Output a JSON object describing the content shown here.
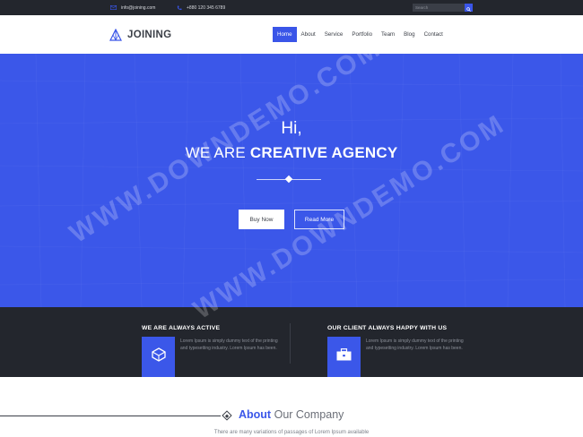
{
  "topbar": {
    "email": "info@joining.com",
    "phone": "+880 120 345 6789",
    "search_placeholder": "Search"
  },
  "header": {
    "logo_text": "JOINING",
    "nav": [
      "Home",
      "About",
      "Service",
      "Portfolio",
      "Team",
      "Blog",
      "Contact"
    ],
    "active_nav": "Home"
  },
  "hero": {
    "greeting": "Hi,",
    "headline_prefix": "WE ARE",
    "headline_emphasis": "CREATIVE AGENCY",
    "buy_label": "Buy Now",
    "read_label": "Read More"
  },
  "features": [
    {
      "title": "WE ARE ALWAYS ACTIVE",
      "text": "Lorem Ipsum is simply dummy text of the printing and typesetting industry. Lorem Ipsum has been.",
      "icon": "cube-icon"
    },
    {
      "title": "OUR CLIENT ALWAYS HAPPY WITH US",
      "text": "Lorem Ipsum is simply dummy text of the printing and typesetting industry. Lorem Ipsum has been.",
      "icon": "briefcase-icon"
    }
  ],
  "about": {
    "title_emphasis": "About",
    "title_rest": "Our Company",
    "subtitle": "There are many variations of passages of Lorem Ipsum available"
  },
  "watermark": "WWW.DOWNDEMO.COM",
  "colors": {
    "brand_blue": "#3b57e9",
    "dark": "#23262d",
    "text": "#3b3f47"
  }
}
